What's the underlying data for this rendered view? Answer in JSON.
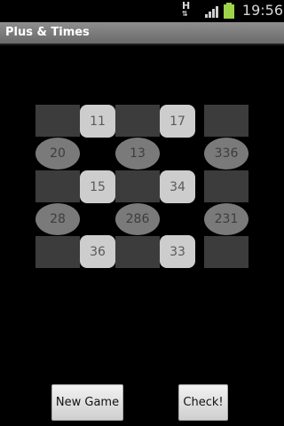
{
  "status_bar": {
    "network_type": "H",
    "network_arrows": "⇅",
    "signal_icon": "signal-bars-icon",
    "battery_icon": "battery-icon",
    "battery_color": "#9ed34a",
    "time": "19:56"
  },
  "app": {
    "title": "Plus & Times"
  },
  "board": {
    "row1": [
      "",
      "11",
      "",
      "17",
      ""
    ],
    "row2": [
      "20",
      "13",
      "336"
    ],
    "row3": [
      "",
      "15",
      "",
      "34",
      ""
    ],
    "row4": [
      "28",
      "286",
      "231"
    ],
    "row5": [
      "",
      "36",
      "",
      "33",
      ""
    ]
  },
  "buttons": {
    "new_game": "New Game",
    "check": "Check!"
  }
}
